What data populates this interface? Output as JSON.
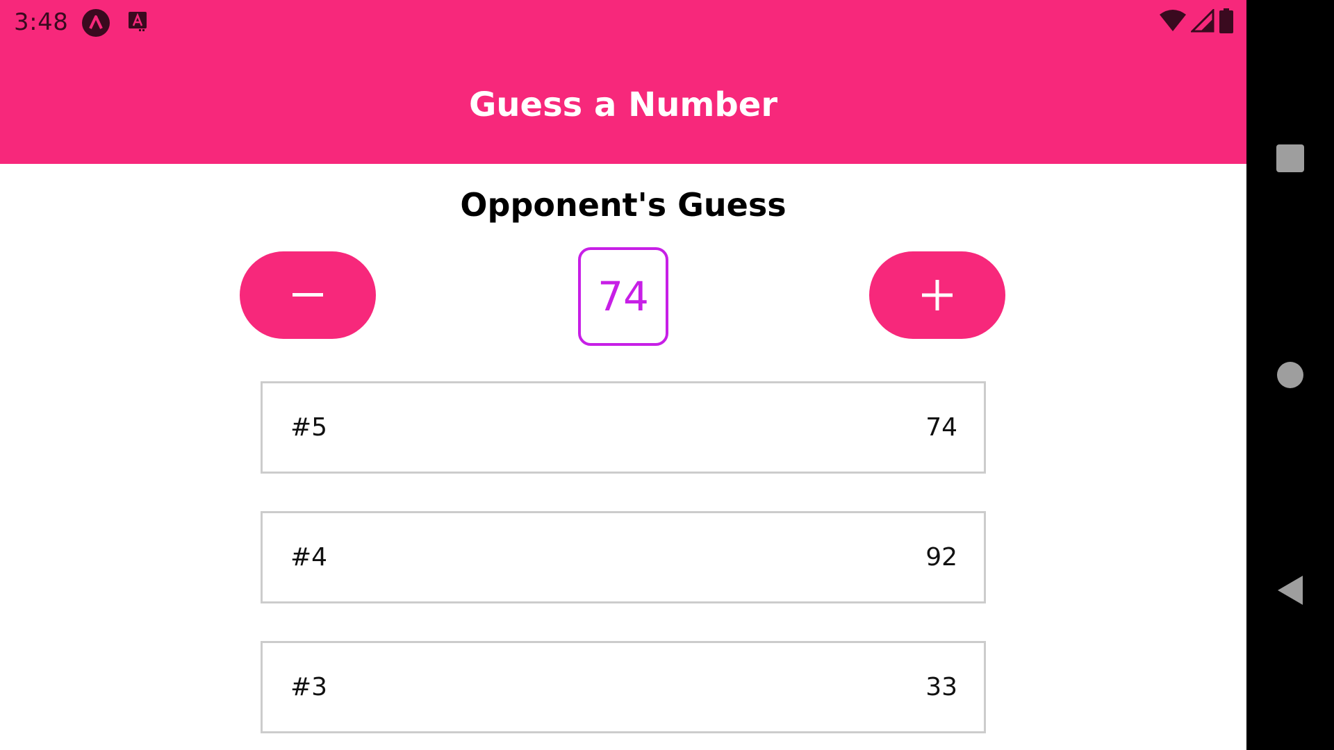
{
  "status_bar": {
    "time": "3:48",
    "icons": [
      "app-launcher-icon",
      "accessibility-icon",
      "wifi-icon",
      "signal-icon",
      "battery-icon"
    ]
  },
  "app_bar": {
    "title": "Guess a Number"
  },
  "game": {
    "heading": "Opponent's Guess",
    "current_guess": "74",
    "minus_label": "−",
    "plus_label": "+"
  },
  "guesses": [
    {
      "round": "#5",
      "value": "74"
    },
    {
      "round": "#4",
      "value": "92"
    },
    {
      "round": "#3",
      "value": "33"
    }
  ],
  "colors": {
    "primary": "#f7287b",
    "accent": "#c71fe6"
  },
  "nav_bar": {
    "buttons": [
      "recents-icon",
      "home-icon",
      "back-icon"
    ]
  }
}
